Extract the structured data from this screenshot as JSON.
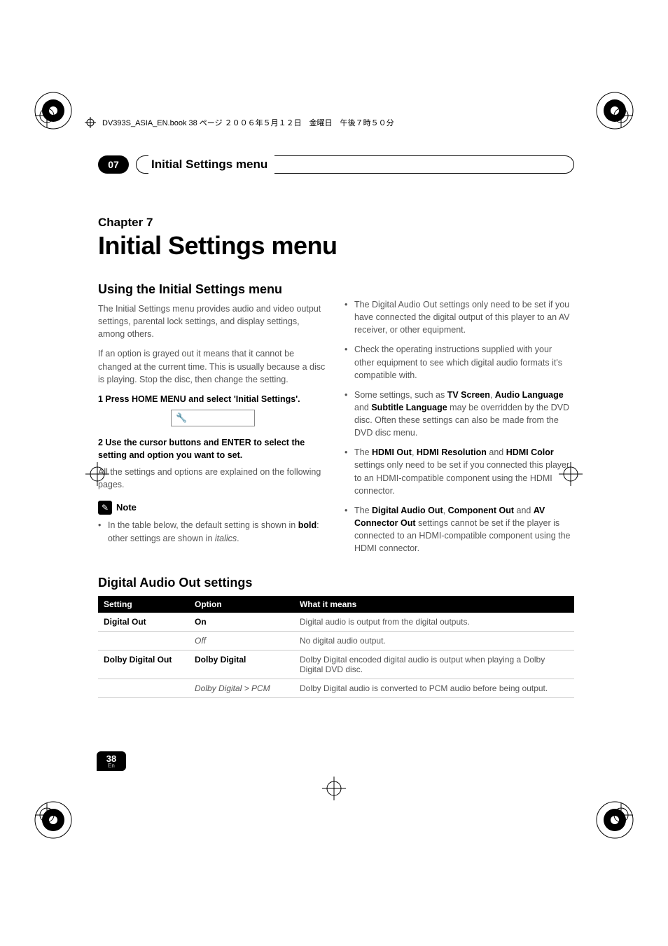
{
  "header_text": "DV393S_ASIA_EN.book 38 ページ ２００６年５月１２日　金曜日　午後７時５０分",
  "chapter_bar": {
    "num": "07",
    "title": "Initial Settings menu"
  },
  "chapter_label": "Chapter 7",
  "main_title": "Initial Settings menu",
  "left": {
    "section_h": "Using the Initial Settings menu",
    "p1": "The Initial Settings menu provides audio and video output settings, parental lock settings, and display settings, among others.",
    "p2": "If an option is grayed out it means that it cannot be changed at the current time. This is usually because a disc is playing. Stop the disc, then change the setting.",
    "step1": "1    Press HOME MENU and select 'Initial Settings'.",
    "step2": "2    Use the cursor buttons and ENTER to select the setting and option you want to set.",
    "step2_after": "All the settings and options are explained on the following pages.",
    "note_label": "Note",
    "note_bullet_pre": "In the table below, the default setting is shown in ",
    "note_bullet_bold": "bold",
    "note_bullet_mid": ": other settings are shown in ",
    "note_bullet_italic": "italics",
    "note_bullet_post": "."
  },
  "right_bullets": [
    {
      "text": "The Digital Audio Out settings only need to be set if you have connected the digital output of this player to an AV receiver, or other equipment."
    },
    {
      "text": "Check the operating instructions supplied with your other equipment to see which digital audio formats it's compatible with."
    },
    {
      "pre": "Some settings, such as ",
      "b1": "TV Screen",
      "m1": ", ",
      "b2": "Audio Language",
      "m2": " and ",
      "b3": "Subtitle Language",
      "post": " may be overridden by the DVD disc. Often these settings can also be made from the DVD disc menu."
    },
    {
      "pre": "The ",
      "b1": "HDMI Out",
      "m1": ", ",
      "b2": "HDMI Resolution",
      "m2": " and ",
      "b3": "HDMI Color",
      "post": " settings only need to be set if you connected this player to an HDMI-compatible component using the HDMI connector."
    },
    {
      "pre": "The ",
      "b1": "Digital Audio Out",
      "m1": ", ",
      "b2": "Component Out",
      "m2": " and ",
      "b3": "AV Connector Out",
      "post": " settings cannot be set if the player is connected to an HDMI-compatible component using the HDMI connector."
    }
  ],
  "table_section_h": "Digital Audio Out settings",
  "table": {
    "headers": [
      "Setting",
      "Option",
      "What it means"
    ],
    "rows": [
      {
        "setting": "Digital Out",
        "option": "On",
        "option_style": "bold",
        "meaning": "Digital audio is output from the digital outputs."
      },
      {
        "setting": "",
        "option": "Off",
        "option_style": "italic",
        "meaning": "No digital audio output."
      },
      {
        "setting": "Dolby Digital Out",
        "option": "Dolby Digital",
        "option_style": "bold",
        "meaning": "Dolby Digital encoded digital audio is output when playing a Dolby Digital DVD disc."
      },
      {
        "setting": "",
        "option": "Dolby Digital > PCM",
        "option_style": "italic",
        "meaning": "Dolby Digital audio is converted to PCM audio before being output."
      }
    ]
  },
  "page_badge": {
    "num": "38",
    "lang": "En"
  }
}
